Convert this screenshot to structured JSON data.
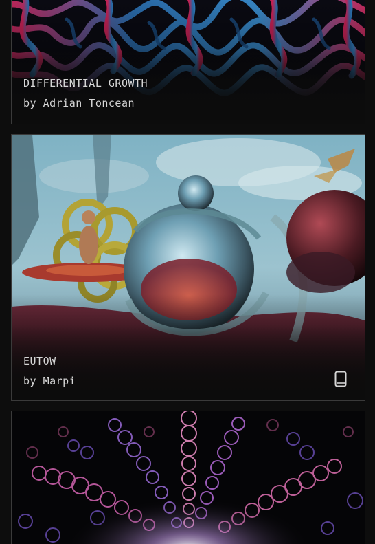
{
  "gallery": {
    "cards": [
      {
        "title": "DIFFERENTIAL GROWTH",
        "artist": "by Adrian Toncean",
        "device_icon": null
      },
      {
        "title": "EUTOW",
        "artist": "by Marpi",
        "device_icon": "mobile-device-icon"
      },
      {
        "title": "",
        "artist": "",
        "device_icon": null
      }
    ]
  },
  "colors": {
    "background": "#0d0d0d",
    "text": "#d6d6d6",
    "card_border": "#3a3a3a"
  }
}
